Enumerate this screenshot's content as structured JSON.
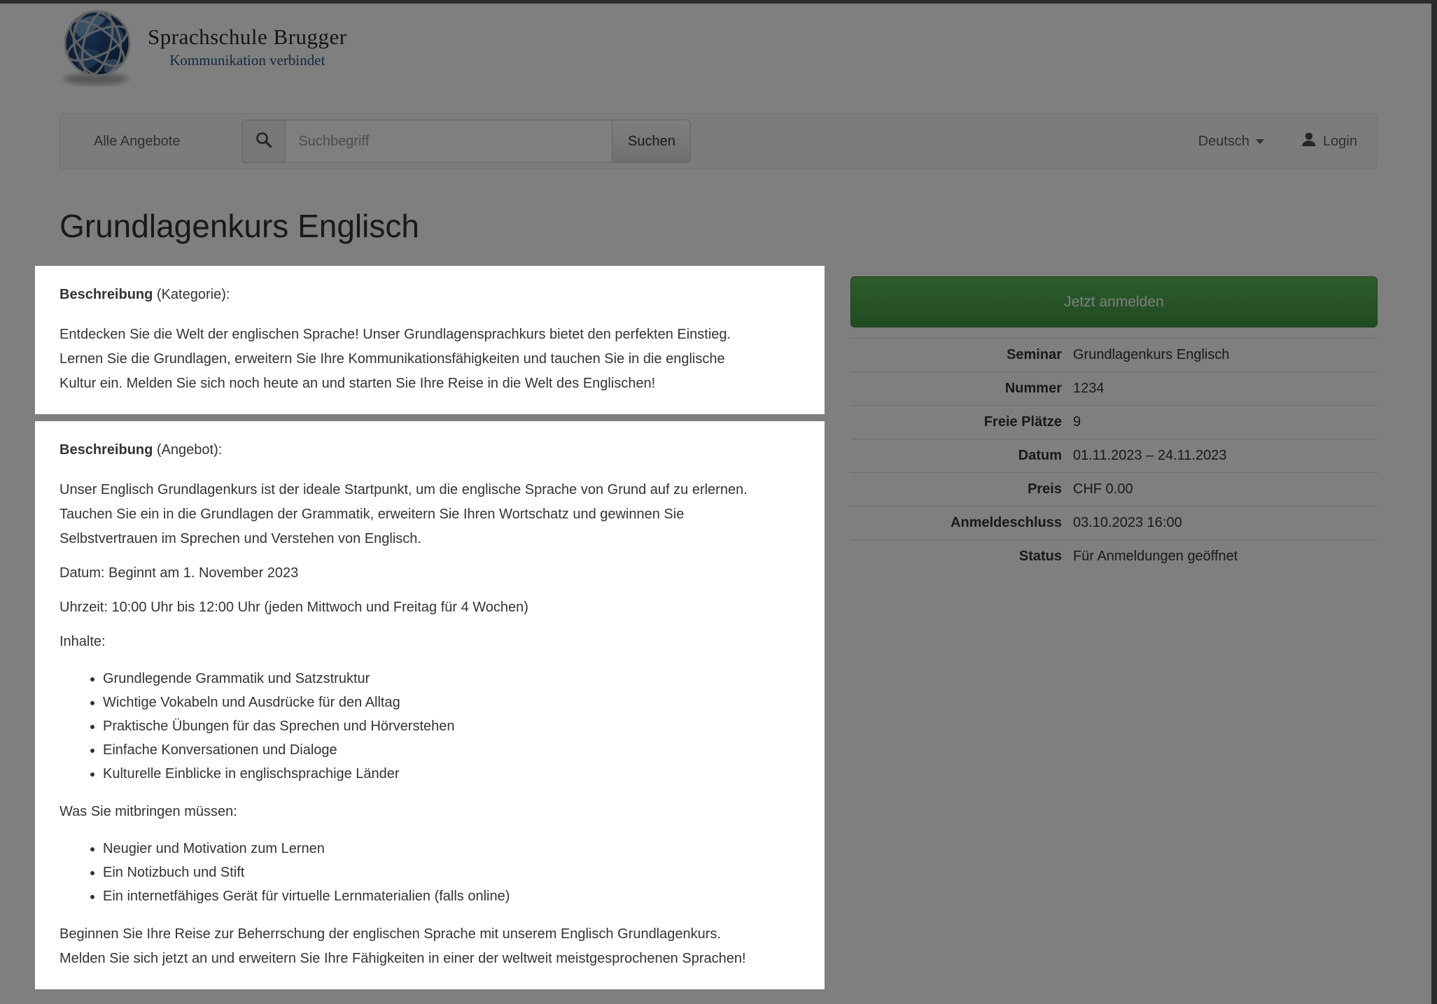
{
  "brand": {
    "name": "Sprachschule Brugger",
    "tagline": "Kommunikation verbindet"
  },
  "nav": {
    "all_offers": "Alle Angebote",
    "search_placeholder": "Suchbegriff",
    "search_button": "Suchen",
    "language": "Deutsch",
    "login": "Login"
  },
  "page": {
    "title": "Grundlagenkurs Englisch"
  },
  "category_description": {
    "heading_bold": "Beschreibung",
    "heading_rest": " (Kategorie):",
    "text": "Entdecken Sie die Welt der englischen Sprache! Unser Grundlagensprachkurs bietet den perfekten Einstieg. Lernen Sie die Grundlagen, erweitern Sie Ihre Kommunikationsfähigkeiten und tauchen Sie in die englische Kultur ein. Melden Sie sich noch heute an und starten Sie Ihre Reise in die Welt des Englischen!"
  },
  "offer_description": {
    "heading_bold": "Beschreibung",
    "heading_rest": " (Angebot):",
    "intro": "Unser Englisch Grundlagenkurs ist der ideale Startpunkt, um die englische Sprache von Grund auf zu erlernen. Tauchen Sie ein in die Grundlagen der Grammatik, erweitern Sie Ihren Wortschatz und gewinnen Sie Selbstvertrauen im Sprechen und Verstehen von Englisch.",
    "datum_line": "Datum: Beginnt am 1. November 2023",
    "uhrzeit_line": "Uhrzeit: 10:00 Uhr bis 12:00 Uhr (jeden Mittwoch und Freitag für 4 Wochen)",
    "inhalte_label": "Inhalte:",
    "inhalte_items": [
      "Grundlegende Grammatik und Satzstruktur",
      "Wichtige Vokabeln und Ausdrücke für den Alltag",
      "Praktische Übungen für das Sprechen und Hörverstehen",
      "Einfache Konversationen und Dialoge",
      "Kulturelle Einblicke in englischsprachige Länder"
    ],
    "mitbringen_label": "Was Sie mitbringen müssen:",
    "mitbringen_items": [
      "Neugier und Motivation zum Lernen",
      "Ein Notizbuch und Stift",
      "Ein internetfähiges Gerät für virtuelle Lernmaterialien (falls online)"
    ],
    "outro": "Beginnen Sie Ihre Reise zur Beherrschung der englischen Sprache mit unserem Englisch Grundlagenkurs. Melden Sie sich jetzt an und erweitern Sie Ihre Fähigkeiten in einer der weltweit meistgesprochenen Sprachen!"
  },
  "sidebar": {
    "register_button": "Jetzt anmelden",
    "details": [
      {
        "label": "Seminar",
        "value": "Grundlagenkurs Englisch"
      },
      {
        "label": "Nummer",
        "value": "1234"
      },
      {
        "label": "Freie Plätze",
        "value": "9"
      },
      {
        "label": "Datum",
        "value": "01.11.2023 – 24.11.2023"
      },
      {
        "label": "Preis",
        "value": "CHF 0.00"
      },
      {
        "label": "Anmeldeschluss",
        "value": "03.10.2023 16:00"
      },
      {
        "label": "Status",
        "value": "Für Anmeldungen geöffnet"
      }
    ]
  },
  "colors": {
    "accent_green": "#5cb85c",
    "brand_blue": "#27537f",
    "dim_overlay": "rgba(0,0,0,0.5)"
  }
}
